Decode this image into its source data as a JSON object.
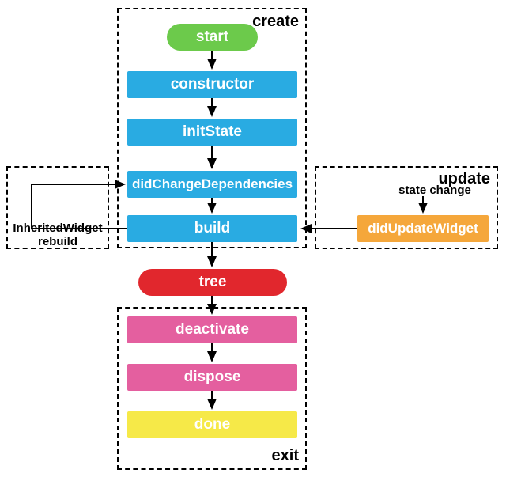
{
  "panels": {
    "create": {
      "label": "create"
    },
    "update": {
      "label": "update"
    },
    "inherited": {
      "label": ""
    },
    "exit": {
      "label": "exit"
    }
  },
  "nodes": {
    "start": "start",
    "constructor": "constructor",
    "initState": "initState",
    "didChangeDependencies": "didChangeDependencies",
    "build": "build",
    "tree": "tree",
    "deactivate": "deactivate",
    "dispose": "dispose",
    "done": "done",
    "didUpdateWidget": "didUpdateWidget"
  },
  "labels": {
    "inheritedRebuild": "InheritedWidget\nrebuild",
    "stateChange": "state change"
  }
}
